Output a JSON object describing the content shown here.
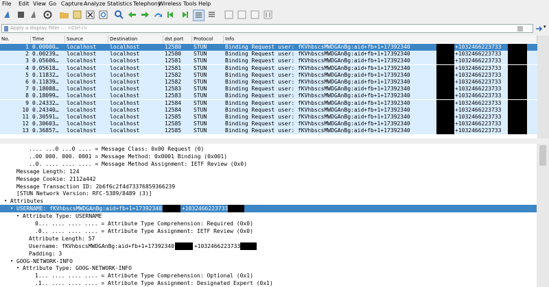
{
  "menu": [
    "File",
    "Edit",
    "View",
    "Go",
    "Capture",
    "Analyze",
    "Statistics",
    "Telephony",
    "Wireless",
    "Tools",
    "Help"
  ],
  "filter": {
    "placeholder": "Apply a display filter … <Ctrl-/>"
  },
  "columns": [
    "No.",
    "Time",
    "Source",
    "Destination",
    "dst port",
    "Protocol",
    "Info"
  ],
  "packets": [
    {
      "no": "1",
      "time": "0.00000…",
      "src": "localhost",
      "dst": "localhost",
      "port": "12580",
      "proto": "STUN",
      "info": "Binding Request user: fKVhbscsMWDGAnBg:aid+fb+1+17392340",
      "info2": "+1032466223733"
    },
    {
      "no": "2",
      "time": "0.00239…",
      "src": "localhost",
      "dst": "localhost",
      "port": "12580",
      "proto": "STUN",
      "info": "Binding Request user: fKVhbscsMWDGAnBg:aid+fb+1+17392340",
      "info2": "+1032466223733"
    },
    {
      "no": "3",
      "time": "0.05606…",
      "src": "localhost",
      "dst": "localhost",
      "port": "12581",
      "proto": "STUN",
      "info": "Binding Request user: fKVhbscsMWDGAnBg:aid+fb+1+17392340",
      "info2": "+1032466223733"
    },
    {
      "no": "4",
      "time": "0.05618…",
      "src": "localhost",
      "dst": "localhost",
      "port": "12581",
      "proto": "STUN",
      "info": "Binding Request user: fKVhbscsMWDGAnBg:aid+fb+1+17392340",
      "info2": "+1032466223733"
    },
    {
      "no": "5",
      "time": "0.11832…",
      "src": "localhost",
      "dst": "localhost",
      "port": "12582",
      "proto": "STUN",
      "info": "Binding Request user: fKVhbscsMWDGAnBg:aid+fb+1+17392340",
      "info2": "+1032466223733"
    },
    {
      "no": "6",
      "time": "0.11839…",
      "src": "localhost",
      "dst": "localhost",
      "port": "12582",
      "proto": "STUN",
      "info": "Binding Request user: fKVhbscsMWDGAnBg:aid+fb+1+17392340",
      "info2": "+1032466223733"
    },
    {
      "no": "7",
      "time": "0.18088…",
      "src": "localhost",
      "dst": "localhost",
      "port": "12583",
      "proto": "STUN",
      "info": "Binding Request user: fKVhbscsMWDGAnBg:aid+fb+1+17392340",
      "info2": "+1032466223733"
    },
    {
      "no": "8",
      "time": "0.18099…",
      "src": "localhost",
      "dst": "localhost",
      "port": "12583",
      "proto": "STUN",
      "info": "Binding Request user: fKVhbscsMWDGAnBg:aid+fb+1+17392340",
      "info2": "+1032466223733"
    },
    {
      "no": "9",
      "time": "0.24332…",
      "src": "localhost",
      "dst": "localhost",
      "port": "12584",
      "proto": "STUN",
      "info": "Binding Request user: fKVhbscsMWDGAnBg:aid+fb+1+17392340",
      "info2": "+1032466223733"
    },
    {
      "no": "10",
      "time": "0.24340…",
      "src": "localhost",
      "dst": "localhost",
      "port": "12584",
      "proto": "STUN",
      "info": "Binding Request user: fKVhbscsMWDGAnBg:aid+fb+1+17392340",
      "info2": "+1032466223733"
    },
    {
      "no": "11",
      "time": "0.30591…",
      "src": "localhost",
      "dst": "localhost",
      "port": "12585",
      "proto": "STUN",
      "info": "Binding Request user: fKVhbscsMWDGAnBg:aid+fb+1+17392340",
      "info2": "+1032466223733"
    },
    {
      "no": "12",
      "time": "0.30603…",
      "src": "localhost",
      "dst": "localhost",
      "port": "12585",
      "proto": "STUN",
      "info": "Binding Request user: fKVhbscsMWDGAnBg:aid+fb+1+17392340",
      "info2": "+1032466223733"
    },
    {
      "no": "13",
      "time": "0.36857…",
      "src": "localhost",
      "dst": "localhost",
      "port": "12585",
      "proto": "STUN",
      "info": "Binding Request user: fKVhbscsMWDGAnBg:aid+fb+1+17392340",
      "info2": "+1032466223733"
    }
  ],
  "details": [
    {
      "indent": 4,
      "arrow": "",
      "text": ".... ...0 ...0 .... = Message Class: 0x00 Request (0)"
    },
    {
      "indent": 4,
      "arrow": "",
      "text": "..00 000. 000. 0001 = Message Method: 0x0001 Binding (0x001)"
    },
    {
      "indent": 4,
      "arrow": "",
      "text": "..0. .... .... .... = Message Method Assignment: IETF Review (0x0)"
    },
    {
      "indent": 2,
      "arrow": "",
      "text": "Message Length: 124"
    },
    {
      "indent": 2,
      "arrow": "",
      "text": "Message Cookie: 2112a442"
    },
    {
      "indent": 2,
      "arrow": "",
      "text": "Message Transaction ID: 2b6f6c2f4d73376859366239"
    },
    {
      "indent": 2,
      "arrow": "",
      "text": "[STUN Network Version: RFC-5389/8489 (3)]"
    },
    {
      "indent": 1,
      "arrow": "▾",
      "text": "Attributes"
    },
    {
      "indent": 2,
      "arrow": "▾",
      "text": "USERNAME: fKVhbscsMWDGAnBg:aid+fb+1+17392340      +1032466223733",
      "sel": true
    },
    {
      "indent": 3,
      "arrow": "▾",
      "text": "Attribute Type: USERNAME"
    },
    {
      "indent": 5,
      "arrow": "",
      "text": "0... .... .... .... = Attribute Type Comprehension: Required (0x0)"
    },
    {
      "indent": 5,
      "arrow": "",
      "text": ".0.. .... .... .... = Attribute Type Assignment: IETF Review (0x0)"
    },
    {
      "indent": 4,
      "arrow": "",
      "text": "Attribute Length: 57"
    },
    {
      "indent": 4,
      "arrow": "",
      "text": "Username: fKVhbscsMWDGAnBg:aid+fb+1+17392340      +1032466223733"
    },
    {
      "indent": 4,
      "arrow": "",
      "text": "Padding: 3"
    },
    {
      "indent": 2,
      "arrow": "▾",
      "text": "GOOG-NETWORK-INFO"
    },
    {
      "indent": 3,
      "arrow": "▾",
      "text": "Attribute Type: GOOG-NETWORK-INFO"
    },
    {
      "indent": 5,
      "arrow": "",
      "text": "1... .... .... .... = Attribute Type Comprehension: Optional (0x1)"
    },
    {
      "indent": 5,
      "arrow": "",
      "text": ".1.. .... .... .... = Attribute Type Assignment: Designated Expert (0x1)"
    }
  ]
}
